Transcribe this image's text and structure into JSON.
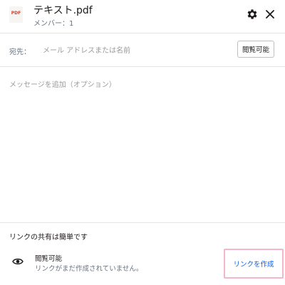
{
  "file": {
    "icon_label": "PDF",
    "name": "テキスト.pdf",
    "member_count": "メンバー：1"
  },
  "header": {
    "settings_icon": "gear-icon",
    "close_icon": "close-icon"
  },
  "recipient": {
    "label": "宛先：",
    "placeholder": "メール アドレスまたは名前",
    "value": "",
    "permission_label": "閲覧可能"
  },
  "message": {
    "placeholder": "メッセージを追加（オプション）",
    "value": ""
  },
  "link_section": {
    "heading": "リンクの共有は簡単です",
    "icon": "eye-icon",
    "permission": "閲覧可能",
    "status": "リンクがまだ作成されていません。",
    "create_label": "リンクを作成"
  },
  "colors": {
    "pdf_red": "#d93b2b",
    "link_blue": "#0061fe",
    "highlight_pink": "#f4b6cf",
    "secondary_text": "#637282"
  }
}
